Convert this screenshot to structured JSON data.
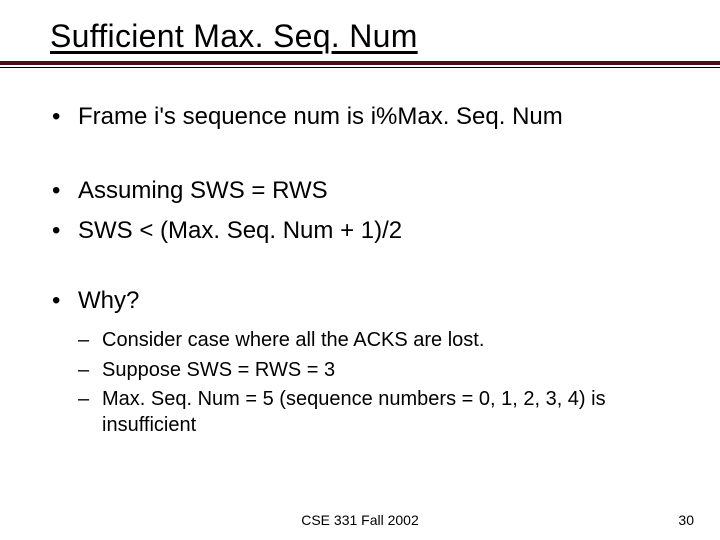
{
  "title": "Sufficient Max. Seq. Num",
  "bullets": {
    "b0": "Frame i's sequence num is i%Max. Seq. Num",
    "b1": "Assuming SWS = RWS",
    "b2": "SWS < (Max. Seq. Num + 1)/2",
    "b3": "Why?"
  },
  "sub": {
    "s0": "Consider case where all the ACKS are lost.",
    "s1": "Suppose SWS = RWS = 3",
    "s2": "Max. Seq. Num = 5 (sequence numbers = 0, 1, 2, 3, 4) is insufficient"
  },
  "footer": {
    "center": "CSE 331 Fall 2002",
    "page": "30"
  }
}
